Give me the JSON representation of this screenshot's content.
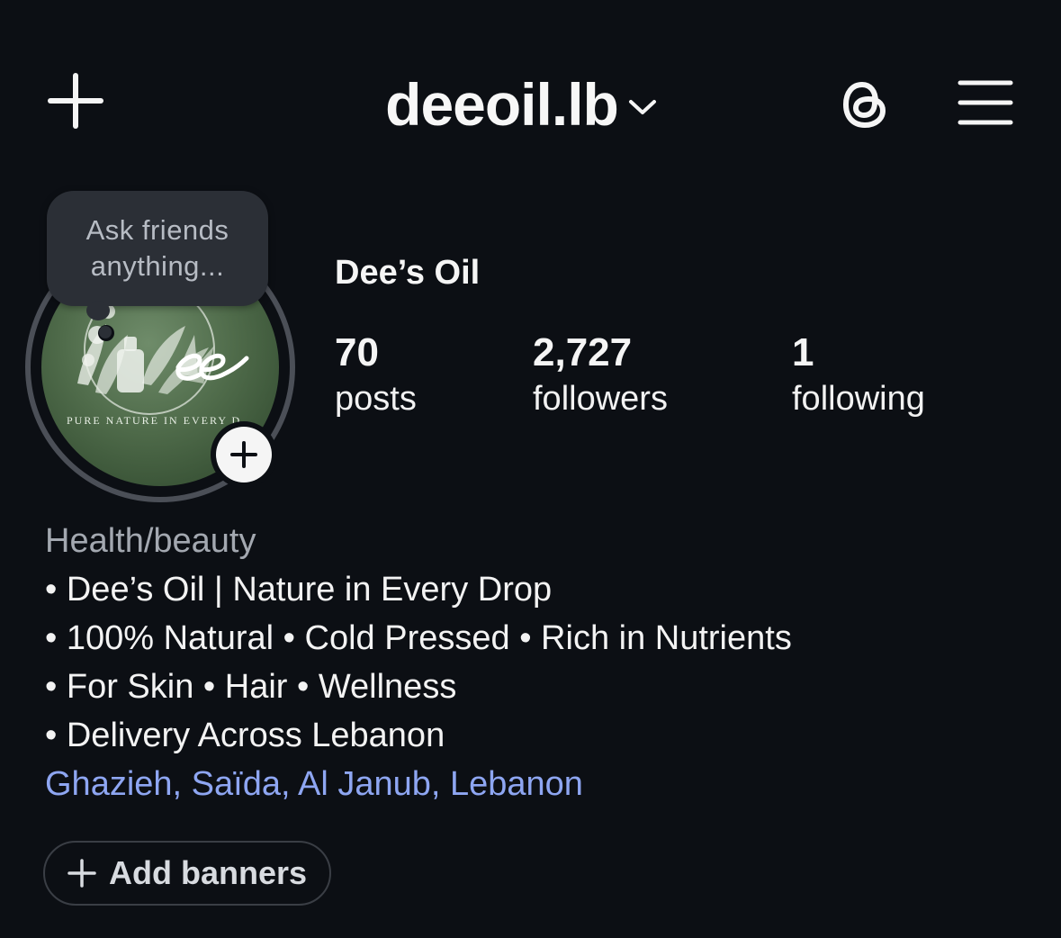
{
  "header": {
    "username": "deeoil.lb",
    "icons": {
      "create": "plus-icon",
      "switch_account": "chevron-down-icon",
      "threads": "threads-icon",
      "menu": "hamburger-menu-icon"
    }
  },
  "profile": {
    "note_placeholder": "Ask friends anything...",
    "avatar_tagline": "PURE NATURE IN EVERY D",
    "display_name": "Dee’s Oil",
    "stats": [
      {
        "value": "70",
        "label": "posts"
      },
      {
        "value": "2,727",
        "label": "followers"
      },
      {
        "value": "1",
        "label": "following"
      }
    ]
  },
  "bio": {
    "category": "Health/beauty",
    "lines": [
      "• Dee’s Oil | Nature in Every Drop",
      "• 100% Natural • Cold Pressed • Rich in Nutrients",
      "• For Skin • Hair • Wellness",
      "• Delivery Across Lebanon"
    ],
    "location": "Ghazieh, Saïda, Al Janub, Lebanon"
  },
  "actions": {
    "add_banners": "Add banners"
  },
  "colors": {
    "background": "#0c0f14",
    "link": "#8ea6f2",
    "muted": "#a3a8b0",
    "bubble": "#2b2f36"
  }
}
